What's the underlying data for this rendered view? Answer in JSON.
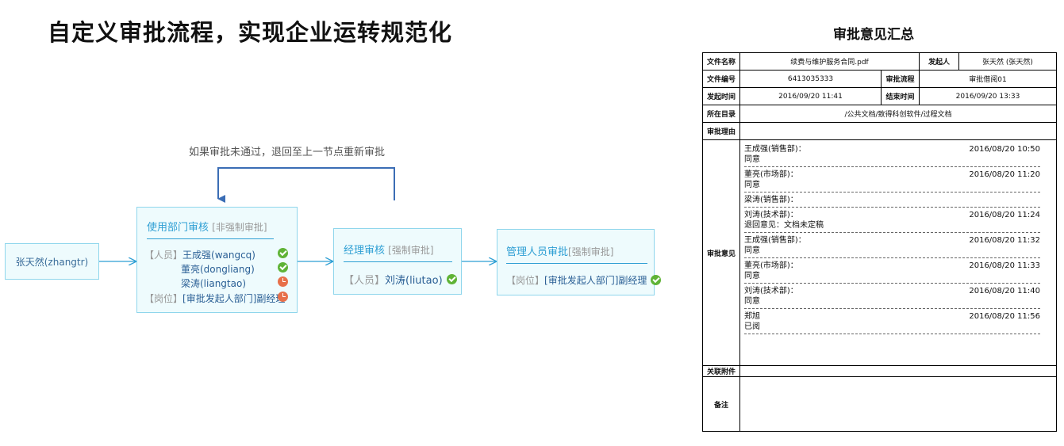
{
  "headline": "自定义审批流程，实现企业运转规范化",
  "flow": {
    "loop_note": "如果审批未通过，退回至上一节点重新审批",
    "start": {
      "label": "张天然(zhangtr)"
    },
    "dept": {
      "title": "使用部门审核",
      "tag": "[非强制审批]",
      "person_label": "【人员】",
      "people": [
        {
          "name": "王成强(wangcq)",
          "status": "ok"
        },
        {
          "name": "董亮(dongliang)",
          "status": "ok"
        },
        {
          "name": "梁涛(liangtao)",
          "status": "pending"
        }
      ],
      "position_label": "【岗位】",
      "position": "[审批发起人部门]副经理",
      "position_status": "pending"
    },
    "manager": {
      "title": "经理审核",
      "tag": "[强制审批]",
      "person_label": "【人员】",
      "person": "刘涛(liutao)",
      "status": "ok"
    },
    "admin": {
      "title": "管理人员审批",
      "tag": "[强制审批]",
      "position_label": "【岗位】",
      "position": "[审批发起人部门]副经理",
      "status": "ok"
    },
    "colors": {
      "line": "#2e9fd4",
      "loop": "#3b6db5",
      "ok": "#5fb336",
      "pending": "#e7704a"
    }
  },
  "summary": {
    "title": "审批意见汇总",
    "labels": {
      "file_name": "文件名称",
      "initiator": "发起人",
      "file_no": "文件编号",
      "process": "审批流程",
      "start_time": "发起时间",
      "end_time": "结束时间",
      "directory": "所在目录",
      "reason": "审批理由",
      "opinions": "审批意见",
      "attachments": "关联附件",
      "notes": "备注"
    },
    "file_name": "续费与维护服务合同.pdf",
    "initiator": "张天然 (张天然)",
    "file_no": "6413035333",
    "process": "审批借阅01",
    "start_time": "2016/09/20 11:41",
    "end_time": "2016/09/20 13:33",
    "directory": "/公共文档/致得科创软件/过程文档",
    "opinions": [
      {
        "who": "王成强(销售部)：",
        "time": "2016/08/20 10:50",
        "text": "同意"
      },
      {
        "who": "董亮(市场部)：",
        "time": "2016/08/20 11:20",
        "text": "同意"
      },
      {
        "who": "梁涛(销售部)：",
        "time": "",
        "text": ""
      },
      {
        "who": "刘涛(技术部)：",
        "time": "2016/08/20 11:24",
        "text": "退回意见：文档未定稿"
      },
      {
        "who": "王成强(销售部)：",
        "time": "2016/08/20 11:32",
        "text": "同意"
      },
      {
        "who": "董亮(市场部)：",
        "time": "2016/08/20 11:33",
        "text": "同意"
      },
      {
        "who": "刘涛(技术部)：",
        "time": "2016/08/20 11:40",
        "text": "同意"
      },
      {
        "who": "郑旭",
        "time": "2016/08/20 11:56",
        "text": "已阅"
      }
    ]
  }
}
